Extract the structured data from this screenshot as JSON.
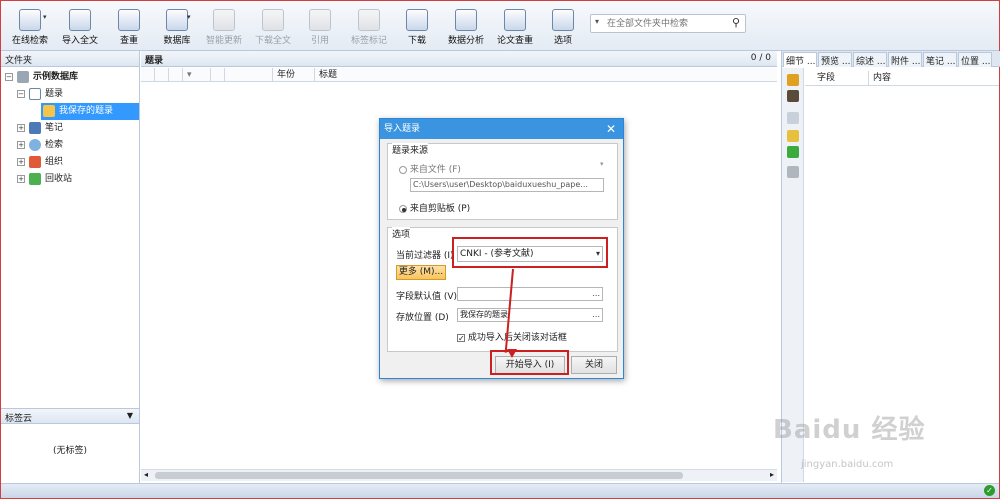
{
  "toolbar": {
    "buttons": [
      {
        "label": "在线检索"
      },
      {
        "label": "导入全文"
      },
      {
        "label": "查重"
      },
      {
        "label": "数据库"
      },
      {
        "label": "智能更新"
      },
      {
        "label": "下载全文"
      },
      {
        "label": "引用"
      },
      {
        "label": "标签标记"
      },
      {
        "label": "下载"
      },
      {
        "label": "数据分析"
      },
      {
        "label": "论文查重"
      },
      {
        "label": "选项"
      }
    ],
    "search_placeholder": "在全部文件夹中检索"
  },
  "left_panel": {
    "title": "文件夹",
    "tree": [
      {
        "label": "示例数据库"
      },
      {
        "label": "题录"
      },
      {
        "label": "我保存的题录"
      },
      {
        "label": "笔记"
      },
      {
        "label": "检索"
      },
      {
        "label": "组织"
      },
      {
        "label": "回收站"
      }
    ],
    "tag_cloud_title": "标签云",
    "tag_cloud_empty": "(无标签)"
  },
  "center": {
    "title": "题录",
    "count": "0 / 0",
    "columns": [
      "年份",
      "标题"
    ]
  },
  "right_panel": {
    "tabs": [
      "细节 ...",
      "预览 ...",
      "综述 ...",
      "附件 ...",
      "笔记 ...",
      "位置 ..."
    ],
    "columns": [
      "字段",
      "内容"
    ]
  },
  "dialog": {
    "title": "导入题录",
    "source_group": "题录来源",
    "from_file": "来自文件 (F)",
    "file_path": "C:\\Users\\user\\Desktop\\baiduxueshu_pape...",
    "from_clipboard": "来自剪贴板 (P)",
    "options_group": "选项",
    "filter_label": "当前过滤器 (I)",
    "filter_value": "CNKI - (参考文献)",
    "more_button": "更多 (M)...",
    "field_default_label": "字段默认值 (V)",
    "store_location_label": "存放位置 (D)",
    "store_location_value": "我保存的题录",
    "close_after_import": "成功导入后关闭该对话框",
    "start_button": "开始导入 (I)",
    "close_button": "关闭",
    "accent_color": "#cc1f1f"
  },
  "watermark": {
    "main": "Baidu 经验",
    "sub": "jingyan.baidu.com"
  }
}
